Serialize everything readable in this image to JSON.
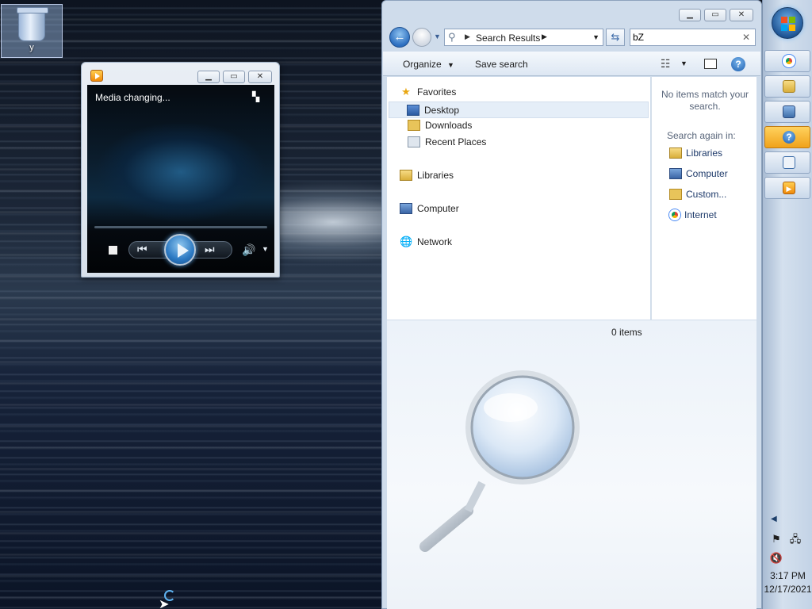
{
  "desktop": {
    "recycle_bin_label": "y"
  },
  "media_player": {
    "status": "Media changing..."
  },
  "explorer": {
    "address": {
      "location": "Search Results"
    },
    "search": {
      "value": "bZ"
    },
    "toolbar": {
      "organize_label": "Organize",
      "save_search_label": "Save search"
    },
    "nav": {
      "favorites": "Favorites",
      "desktop": "Desktop",
      "downloads": "Downloads",
      "recent_places": "Recent Places",
      "libraries": "Libraries",
      "computer": "Computer",
      "network": "Network"
    },
    "details": {
      "no_items": "No items match your search.",
      "search_again": "Search again in:",
      "locations": [
        "Libraries",
        "Computer",
        "Custom...",
        "Internet"
      ]
    },
    "status": {
      "item_count": "0 items"
    }
  },
  "taskbar": {
    "clock_time": "3:17 PM",
    "clock_date": "12/17/2021"
  },
  "colors": {
    "accent_blue": "#2d6fc0",
    "active_task_orange": "#f0a21a",
    "window_frame": "#cfdceb"
  },
  "icons": [
    "recycle-bin-icon",
    "media-player-icon",
    "back-arrow-icon",
    "search-icon",
    "refresh-icon",
    "help-icon",
    "star-icon",
    "desktop-icon",
    "downloads-icon",
    "recent-places-icon",
    "libraries-icon",
    "computer-icon",
    "network-icon",
    "internet-icon",
    "windows-logo-icon",
    "chrome-icon",
    "flag-icon",
    "network-tray-icon",
    "volume-muted-icon"
  ]
}
